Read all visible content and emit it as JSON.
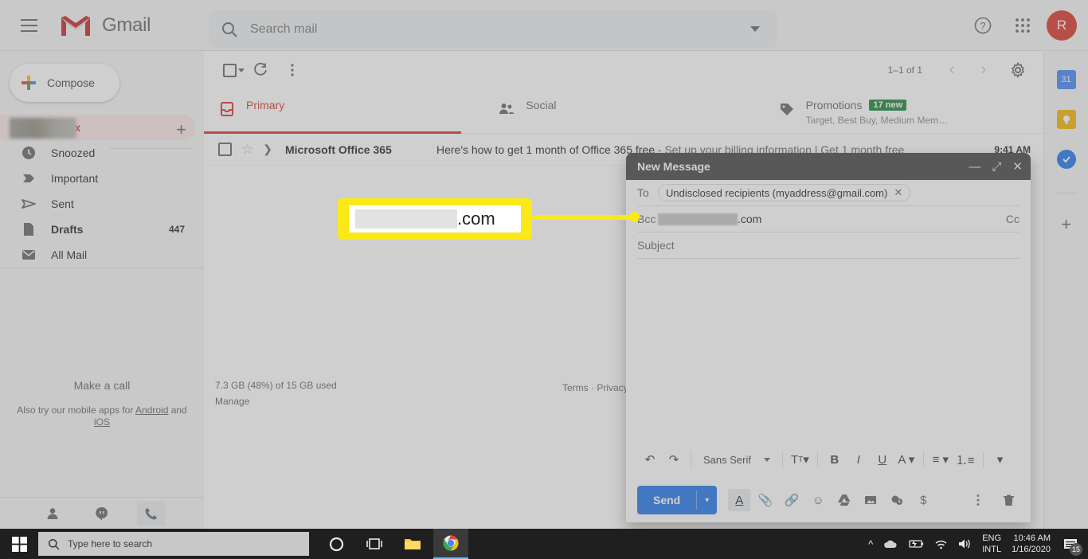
{
  "header": {
    "menu_icon": "hamburger-menu-icon",
    "brand": "Gmail",
    "search_placeholder": "Search mail",
    "search_value": "",
    "help_icon": "help-icon",
    "apps_icon": "apps-grid-icon",
    "avatar_initial": "R"
  },
  "sidebar": {
    "compose_label": "Compose",
    "items": [
      {
        "label": "Inbox",
        "icon": "inbox-icon",
        "count": "",
        "active": true
      },
      {
        "label": "Snoozed",
        "icon": "clock-icon",
        "count": "",
        "active": false
      },
      {
        "label": "Important",
        "icon": "important-marker-icon",
        "count": "",
        "active": false
      },
      {
        "label": "Sent",
        "icon": "send-icon",
        "count": "",
        "active": false
      },
      {
        "label": "Drafts",
        "icon": "draft-file-icon",
        "count": "447",
        "active": false
      },
      {
        "label": "All Mail",
        "icon": "mail-icon",
        "count": "",
        "active": false
      }
    ],
    "hangouts_add": "+",
    "make_a_call": "Make a call",
    "mobile_note_prefix": "Also try our mobile apps for ",
    "mobile_note_android": "Android",
    "mobile_note_mid": " and ",
    "mobile_note_ios": "iOS",
    "chat_icons": [
      "contacts-icon",
      "hangouts-icon",
      "phone-icon"
    ]
  },
  "toolbar": {
    "select_all_icon": "checkbox-icon",
    "select_all_caret": "chevron-down-icon",
    "refresh_icon": "refresh-icon",
    "more_icon": "more-vertical-icon",
    "page_count": "1–1 of 1",
    "prev_icon": "chevron-left-icon",
    "next_icon": "chevron-right-icon",
    "settings_icon": "gear-icon"
  },
  "tabs": [
    {
      "label": "Primary",
      "icon": "inbox-icon",
      "badge": "",
      "subtitle": "",
      "active": true
    },
    {
      "label": "Social",
      "icon": "people-icon",
      "badge": "",
      "subtitle": "",
      "active": false
    },
    {
      "label": "Promotions",
      "icon": "tag-icon",
      "badge": "17 new",
      "subtitle": "Target, Best Buy, Medium Mem…",
      "active": false
    }
  ],
  "mail_rows": [
    {
      "sender": "Microsoft Office 365",
      "subject": "Here's how to get 1 month of Office 365 free",
      "snippet": " - Set up your billing information | Get 1 month free",
      "date": "9:41 AM",
      "star_icon": "star-icon",
      "important_icon": "important-marker-icon"
    }
  ],
  "footer": {
    "storage": "7.3 GB (48%) of 15 GB used",
    "manage": "Manage",
    "legal": "Terms · Privacy · Pr"
  },
  "right_rail": {
    "items": [
      {
        "icon": "google-calendar-icon",
        "glyph": "31",
        "color": "#4285f4"
      },
      {
        "icon": "google-keep-icon",
        "glyph": "◍",
        "color": "#f4b400"
      },
      {
        "icon": "google-tasks-icon",
        "glyph": "✓",
        "color": "#1a73e8"
      }
    ],
    "add_icon": "add-icon",
    "add_glyph": "+"
  },
  "compose": {
    "title": "New Message",
    "minimize_icon": "minimize-icon",
    "expand_icon": "expand-icon",
    "close_icon": "close-icon",
    "to_label": "To",
    "to_chip": "Undisclosed recipients (myaddress@gmail.com)",
    "to_chip_remove": "✕",
    "bcc_label": "Bcc",
    "bcc_value_suffix": ".com",
    "cc_label": "Cc",
    "subject_placeholder": "Subject",
    "body_value": "",
    "format_toolbar": {
      "undo_icon": "undo-icon",
      "redo_icon": "redo-icon",
      "font_name": "Sans Serif",
      "font_caret": "chevron-down-icon",
      "font_size_icon": "font-size-icon",
      "bold": "B",
      "italic": "I",
      "underline": "U",
      "text_color_icon": "text-color-icon",
      "align_icon": "align-icon",
      "list_icon": "numbered-list-icon",
      "more_icon": "more-format-icon"
    },
    "send_label": "Send",
    "send_caret": "chevron-down-icon",
    "action_icons": [
      "formatting-icon",
      "attach-file-icon",
      "insert-link-icon",
      "insert-emoji-icon",
      "google-drive-icon",
      "insert-photo-icon",
      "confidential-mode-icon",
      "insert-money-icon"
    ],
    "more_options_icon": "more-vertical-icon",
    "discard_icon": "trash-icon"
  },
  "callout": {
    "redacted_value": "",
    "visible_text": ".com"
  },
  "taskbar": {
    "start_icon": "windows-start-icon",
    "search_icon": "search-icon",
    "search_placeholder": "Type here to search",
    "apps": [
      "cortana-icon",
      "task-view-icon",
      "file-explorer-icon",
      "google-chrome-icon"
    ],
    "tray": {
      "chevron_icon": "show-hidden-icons-icon",
      "cloud_icon": "onedrive-icon",
      "battery_icon": "battery-charging-icon",
      "wifi_icon": "wifi-icon",
      "volume_icon": "volume-icon",
      "language_line1": "ENG",
      "language_line2": "INTL",
      "time": "10:46 AM",
      "date": "1/16/2020",
      "notification_icon": "action-center-icon",
      "notification_count": "15"
    }
  }
}
